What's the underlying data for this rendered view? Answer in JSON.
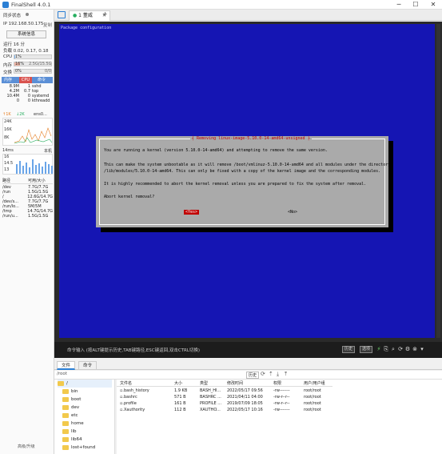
{
  "window": {
    "title": "FinalShell 4.0.1"
  },
  "sidebar": {
    "sync_status": "同步状态",
    "ip_label": "IP 192.168.50.175",
    "copy_label": "复制",
    "sysinfo_button": "系统信息",
    "uptime": "运行 16 分",
    "load": "负载 0.02, 0.17, 0.18",
    "cpu": {
      "label": "CPU",
      "value": "1%",
      "percent": 1
    },
    "mem": {
      "label": "内存",
      "percent_text": "16%",
      "value": "2.5G/15.5G",
      "percent": 16
    },
    "swap": {
      "label": "交换",
      "percent_text": "0%",
      "value": "0/0",
      "percent": 0
    },
    "proc_tabs": [
      "内存",
      "CPU",
      "命令"
    ],
    "processes": [
      {
        "mem": "8.9M",
        "cpu": "1",
        "cmd": "sshd"
      },
      {
        "mem": "4.2M",
        "cpu": "0.7",
        "cmd": "top"
      },
      {
        "mem": "10.4M",
        "cpu": "0",
        "cmd": "systemd"
      },
      {
        "mem": "0",
        "cpu": "0",
        "cmd": "kthreadd"
      }
    ],
    "net": {
      "up": "↑1K",
      "down": "↓2K",
      "iface": "ens0...",
      "ticks": [
        "24K",
        "16K",
        "8K"
      ]
    },
    "latency": {
      "label": "14ms",
      "host": "本机",
      "ticks": [
        "16",
        "14.5",
        "13"
      ]
    },
    "disk_header": {
      "path": "路径",
      "size": "可用/大小"
    },
    "disks": [
      {
        "path": "/dev",
        "size": "7.7G/7.7G"
      },
      {
        "path": "/run",
        "size": "1.5G/1.5G"
      },
      {
        "path": "/",
        "size": "12.6G/14.7G"
      },
      {
        "path": "/dev/s...",
        "size": "7.7G/7.7G"
      },
      {
        "path": "/run/lo...",
        "size": "5M/5M"
      },
      {
        "path": "/tmp",
        "size": "14.7G/14.7G"
      },
      {
        "path": "/run/u...",
        "size": "1.5G/1.5G"
      }
    ],
    "upgrade": "高级/升级"
  },
  "tabs": [
    {
      "label": "1 董威"
    }
  ],
  "add_tab": "+",
  "terminal": {
    "header": "Package configuration",
    "dialog_title": "Removing linux-image-5.10.0-14-amd64-unsigned",
    "lines": [
      "You are running a kernel (version 5.10.0-14-amd64) and attempting to remove the same version.",
      "",
      "This can make the system unbootable as it will remove /boot/vmlinuz-5.10.0-14-amd64 and all modules under the directory",
      "/lib/modules/5.10.0-14-amd64. This can only be fixed with a copy of the kernel image and the corresponding modules.",
      "",
      "It is highly recommended to abort the kernel removal unless you are prepared to fix the system after removal.",
      "",
      "Abort kernel removal?"
    ],
    "yes": "<Yes>",
    "no": "<No>"
  },
  "cmdbar": {
    "hint": "命令输入 (按ALT键提示历史,TAB键路径,ESC键返回,双击CTRL切换)",
    "history": "历史",
    "options": "选项"
  },
  "filebrowser": {
    "tabs": [
      "文件",
      "命令"
    ],
    "path": "/root",
    "history": "历史",
    "tree": [
      "/",
      "bin",
      "boot",
      "dev",
      "etc",
      "home",
      "lib",
      "lib64",
      "lost+found"
    ],
    "columns": [
      "文件名",
      "大小",
      "类型",
      "修改时间",
      "权限",
      "用户/用户组"
    ],
    "files": [
      {
        "name": ".bash_history",
        "size": "1.9 KB",
        "type": "BASH_HI...",
        "mtime": "2022/05/17 09:56",
        "perm": "-rw-------",
        "owner": "root/root"
      },
      {
        "name": ".bashrc",
        "size": "571 B",
        "type": "BASHRC ...",
        "mtime": "2021/04/11 04:00",
        "perm": "-rw-r--r--",
        "owner": "root/root"
      },
      {
        "name": ".profile",
        "size": "161 B",
        "type": "PROFILE ...",
        "mtime": "2019/07/09 18:05",
        "perm": "-rw-r--r--",
        "owner": "root/root"
      },
      {
        "name": ".Xauthority",
        "size": "112 B",
        "type": "XAUTHO...",
        "mtime": "2022/05/17 10:16",
        "perm": "-rw-------",
        "owner": "root/root"
      }
    ]
  }
}
